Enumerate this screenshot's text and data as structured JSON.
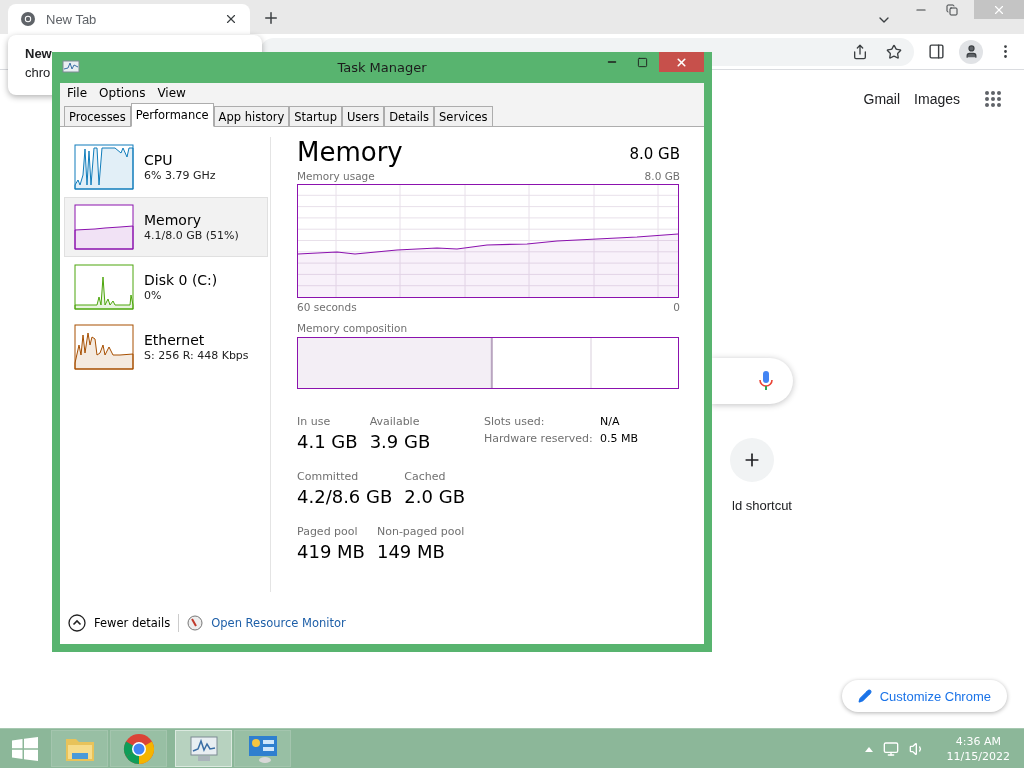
{
  "browser": {
    "tab": {
      "title": "New Tab"
    },
    "tooltip": {
      "title": "New",
      "subtitle": "chro"
    },
    "links": [
      "Gmail",
      "Images"
    ],
    "shortcut": {
      "label": "ld shortcut"
    },
    "customize_button": "Customize Chrome"
  },
  "task_manager": {
    "title": "Task Manager",
    "menu": [
      "File",
      "Options",
      "View"
    ],
    "tabs": [
      {
        "label": "Processes",
        "selected": false
      },
      {
        "label": "Performance",
        "selected": true
      },
      {
        "label": "App history",
        "selected": false
      },
      {
        "label": "Startup",
        "selected": false
      },
      {
        "label": "Users",
        "selected": false
      },
      {
        "label": "Details",
        "selected": false
      },
      {
        "label": "Services",
        "selected": false
      }
    ],
    "sidebar": [
      {
        "kind": "cpu",
        "name": "CPU",
        "detail": "6% 3.79 GHz",
        "selected": false
      },
      {
        "kind": "memory",
        "name": "Memory",
        "detail": "4.1/8.0 GB (51%)",
        "selected": true
      },
      {
        "kind": "disk",
        "name": "Disk 0 (C:)",
        "detail": "0%",
        "selected": false
      },
      {
        "kind": "ethernet",
        "name": "Ethernet",
        "detail": "S: 256 R: 448 Kbps",
        "selected": false
      }
    ],
    "heading": "Memory",
    "total": "8.0 GB",
    "usage": {
      "label": "Memory usage",
      "max": "8.0 GB",
      "axis_start": "60 seconds",
      "axis_end": "0"
    },
    "composition": {
      "label": "Memory composition",
      "level": 0.51
    },
    "stats": [
      [
        {
          "label": "In use",
          "value": "4.1 GB"
        },
        {
          "label": "Available",
          "value": "3.9 GB"
        }
      ],
      [
        {
          "label": "Committed",
          "value": "4.2/8.6 GB"
        },
        {
          "label": "Cached",
          "value": "2.0 GB"
        }
      ],
      [
        {
          "label": "Paged pool",
          "value": "419 MB"
        },
        {
          "label": "Non-paged pool",
          "value": "149 MB"
        }
      ]
    ],
    "hardware": [
      {
        "label": "Slots used:",
        "value": "N/A"
      },
      {
        "label": "Hardware reserved:",
        "value": "0.5 MB"
      }
    ],
    "footer": {
      "fewer": "Fewer details",
      "link": "Open Resource Monitor"
    }
  },
  "taskbar": {
    "items": [
      {
        "kind": "explorer",
        "selected": false
      },
      {
        "kind": "chrome",
        "selected": false
      },
      {
        "kind": "taskmgr",
        "selected": true
      },
      {
        "kind": "control",
        "selected": false
      }
    ],
    "time": "4:36 AM",
    "date": "11/15/2022"
  }
}
